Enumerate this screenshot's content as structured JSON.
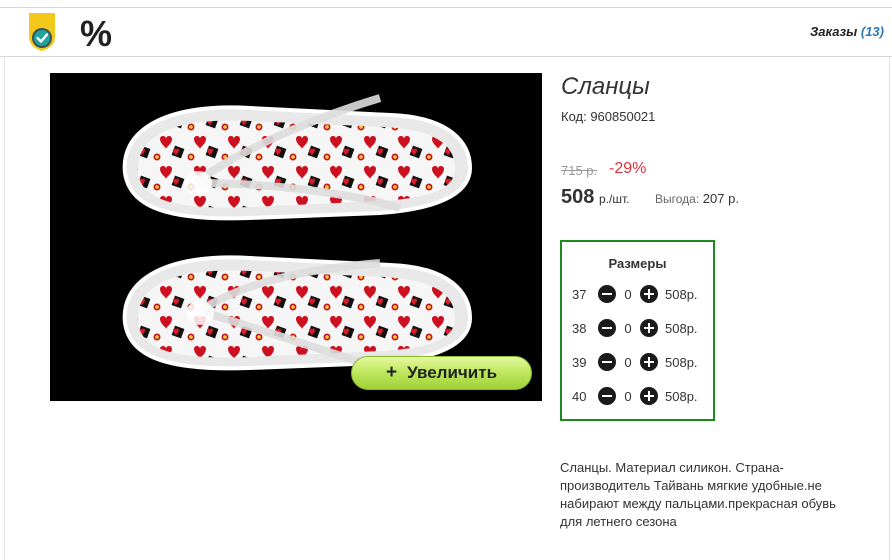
{
  "header": {
    "logo_icon": "shield-check-icon",
    "percent_symbol": "%",
    "orders_label": "Заказы",
    "orders_count": "(13)"
  },
  "product": {
    "image_alt": "",
    "zoom_button": {
      "icon": "+",
      "label": "Увеличить"
    },
    "title": "Сланцы",
    "code": "Код: 960850021",
    "old_price": "715 р.",
    "discount": "-29%",
    "price": "508",
    "price_unit": "р./шт.",
    "savings_label": "Выгода:",
    "savings_value": "207 р.",
    "sizes_title": "Размеры",
    "sizes": [
      {
        "size": "37",
        "qty": "0",
        "price": "508р."
      },
      {
        "size": "38",
        "qty": "0",
        "price": "508р."
      },
      {
        "size": "39",
        "qty": "0",
        "price": "508р."
      },
      {
        "size": "40",
        "qty": "0",
        "price": "508р."
      }
    ],
    "description": "Сланцы. Материал силикон. Страна-производитель Тайвань мягкие удобные.не набирают между пальцами.прекрасная обувь для летнего сезона"
  },
  "colors": {
    "accent_green": "#1c8a1c",
    "discount_red": "#e0303a",
    "orders_blue": "#2a79b8",
    "button_green": "#b0dc50"
  }
}
